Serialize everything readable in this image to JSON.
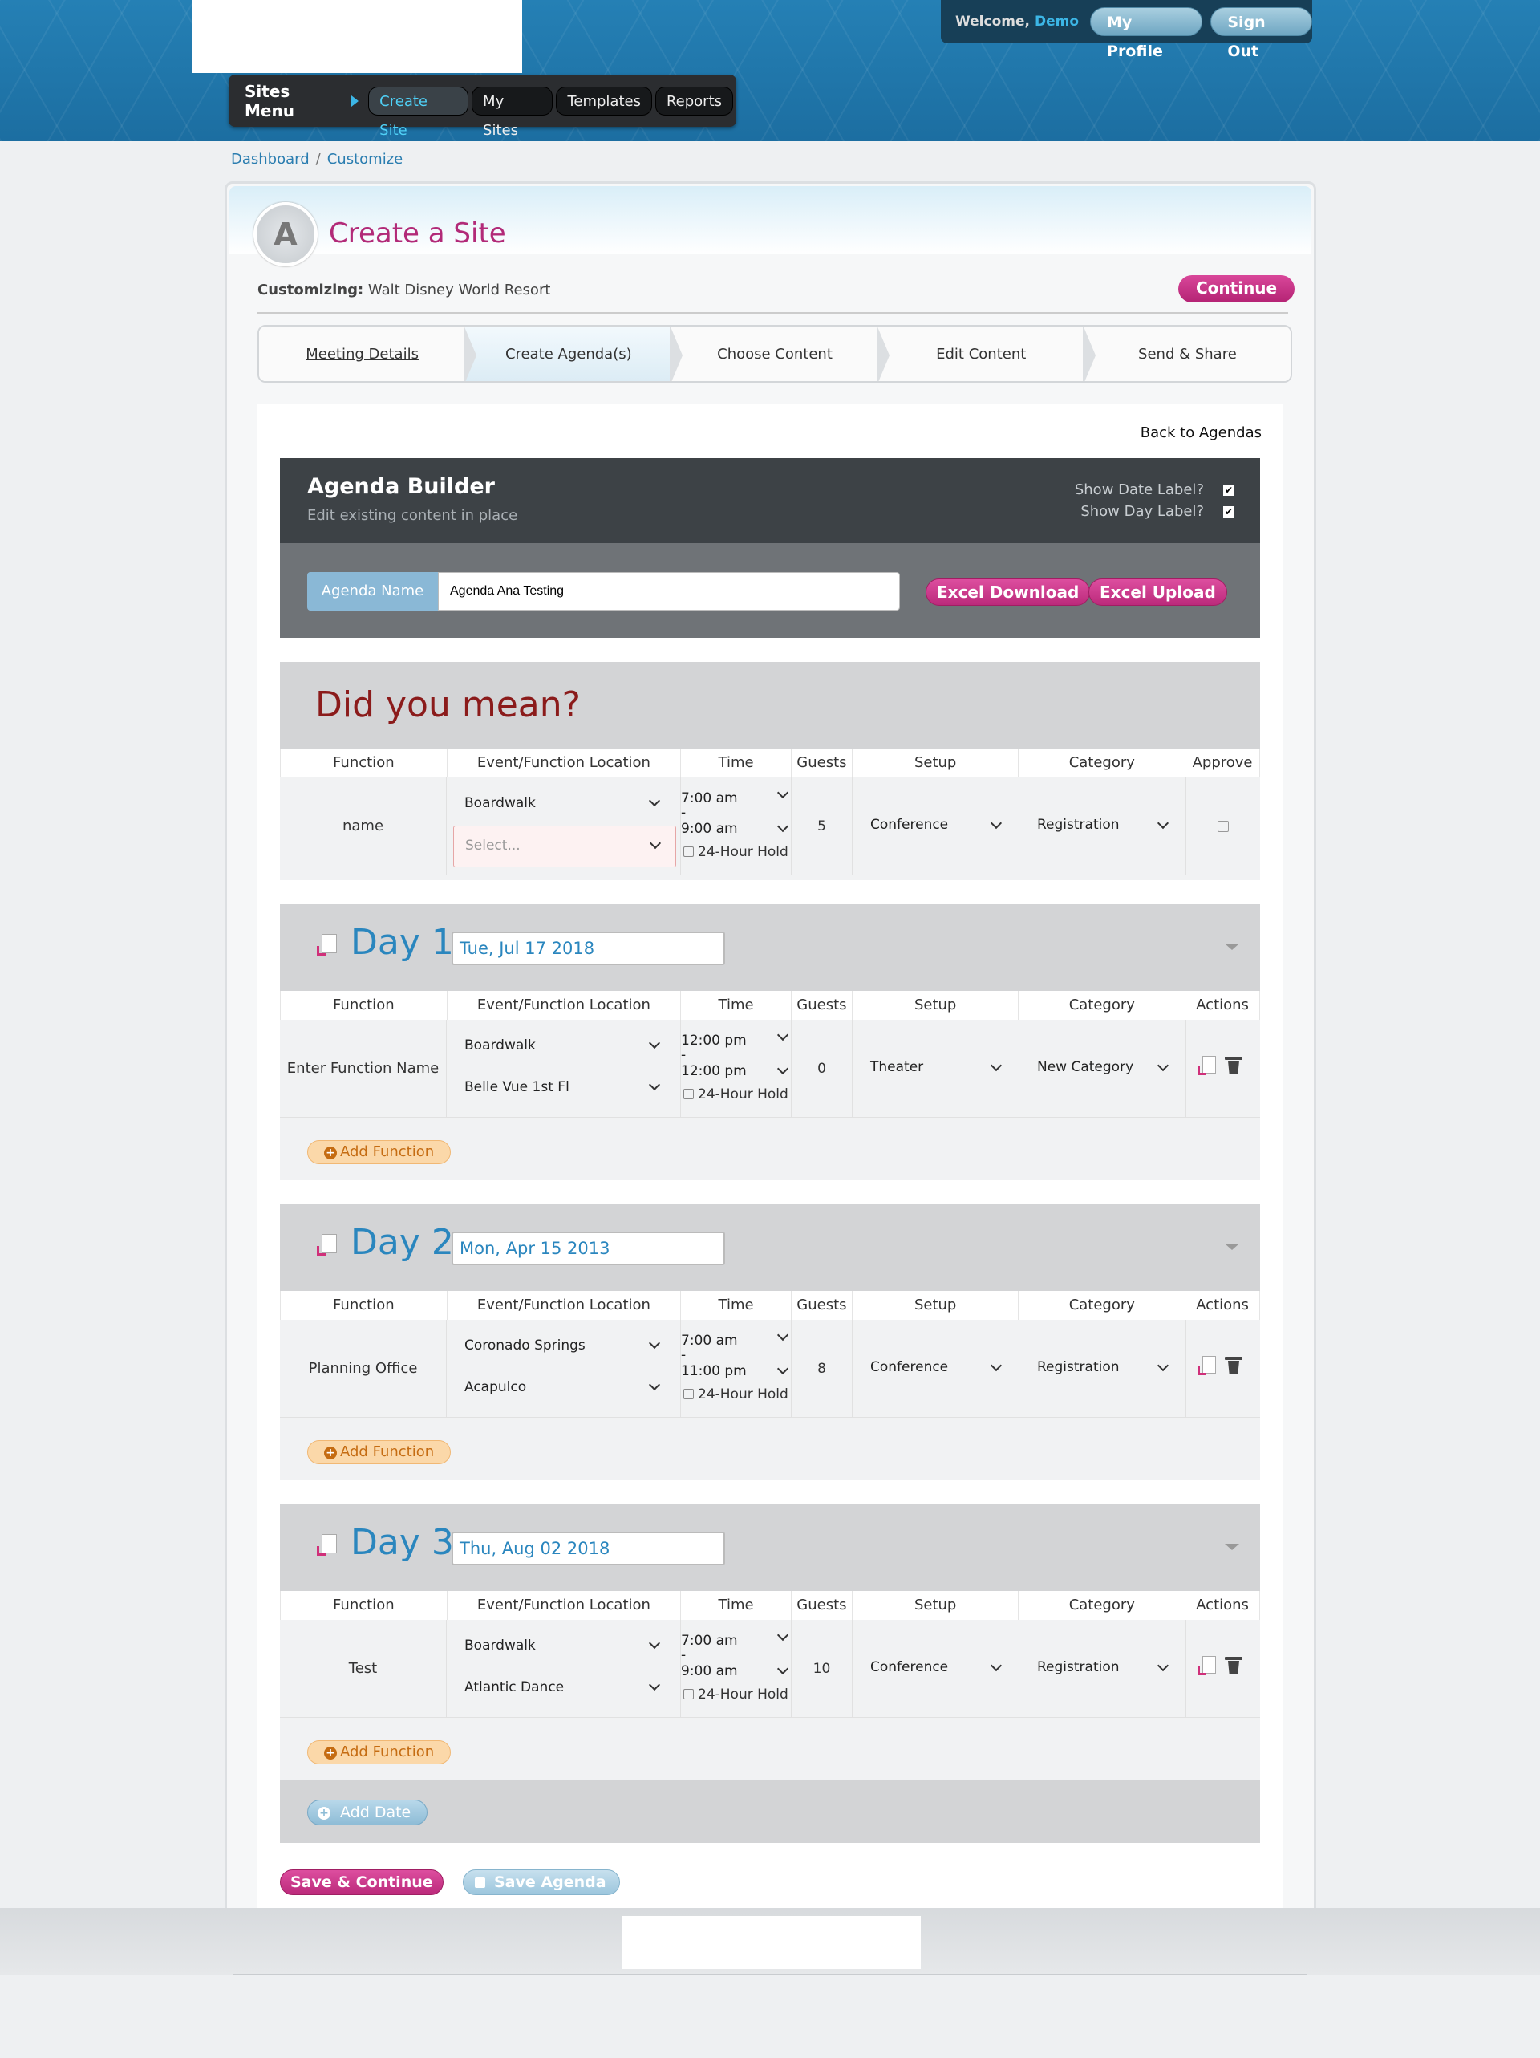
{
  "header": {
    "welcome_text": "Welcome,",
    "user_name": "Demo",
    "my_profile": "My Profile",
    "sign_out": "Sign Out",
    "sites_menu_title": "Sites Menu",
    "menu_items": [
      "Create Site",
      "My Sites",
      "Templates",
      "Reports"
    ]
  },
  "breadcrumb": {
    "items": [
      "Dashboard",
      "Customize"
    ],
    "separator": "/"
  },
  "panel": {
    "title": "Create a Site",
    "customizing_label": "Customizing:",
    "customizing_value": "Walt Disney World Resort",
    "continue_label": "Continue",
    "steps": [
      "Meeting Details",
      "Create Agenda(s)",
      "Choose Content",
      "Edit Content",
      "Send & Share"
    ]
  },
  "back_to_agendas": "Back to Agendas",
  "agenda_builder": {
    "title": "Agenda Builder",
    "subtitle": "Edit existing content in place",
    "show_date_label": "Show Date Label?",
    "show_day_label": "Show Day Label?",
    "show_date_checked": true,
    "show_day_checked": true,
    "agenda_name_label": "Agenda Name",
    "agenda_name_value": "Agenda Ana Testing",
    "excel_download": "Excel Download",
    "excel_upload": "Excel Upload"
  },
  "columns": {
    "function": "Function",
    "location": "Event/Function Location",
    "time": "Time",
    "guests": "Guests",
    "setup": "Setup",
    "category": "Category",
    "approve": "Approve",
    "actions": "Actions"
  },
  "did_you_mean": {
    "title": "Did you mean?",
    "row": {
      "function": "name",
      "location1": "Boardwalk",
      "location2_placeholder": "Select...",
      "start": "7:00 am",
      "dash": "-",
      "end": "9:00 am",
      "hold_label": "24-Hour Hold",
      "guests": "5",
      "setup": "Conference",
      "category": "Registration",
      "approved": false
    }
  },
  "days": [
    {
      "label": "Day 1",
      "date": "Tue, Jul 17 2018",
      "function": "Enter Function Name",
      "location1": "Boardwalk",
      "location2": "Belle Vue 1st Fl",
      "start": "12:00 pm",
      "dash": "-",
      "end": "12:00 pm",
      "hold_label": "24-Hour Hold",
      "guests": "0",
      "setup": "Theater",
      "category": "New Category",
      "add_function": "Add Function"
    },
    {
      "label": "Day 2",
      "date": "Mon, Apr 15 2013",
      "function": "Planning Office",
      "location1": "Coronado Springs",
      "location2": "Acapulco",
      "start": "7:00 am",
      "dash": "-",
      "end": "11:00 pm",
      "hold_label": "24-Hour Hold",
      "guests": "8",
      "setup": "Conference",
      "category": "Registration",
      "add_function": "Add Function"
    },
    {
      "label": "Day 3",
      "date": "Thu, Aug 02 2018",
      "function": "Test",
      "location1": "Boardwalk",
      "location2": "Atlantic Dance",
      "start": "7:00 am",
      "dash": "-",
      "end": "9:00 am",
      "hold_label": "24-Hour Hold",
      "guests": "10",
      "setup": "Conference",
      "category": "Registration",
      "add_function": "Add Function"
    }
  ],
  "add_date": "Add Date",
  "save_continue": "Save & Continue",
  "save_agenda": "Save Agenda",
  "colors": {
    "accent_pink": "#c02d7f",
    "header_blue": "#1f77ab",
    "day_blue": "#2a86be",
    "did_you_mean_red": "#8b1b1b",
    "add_function_orange": "#c56c12"
  }
}
